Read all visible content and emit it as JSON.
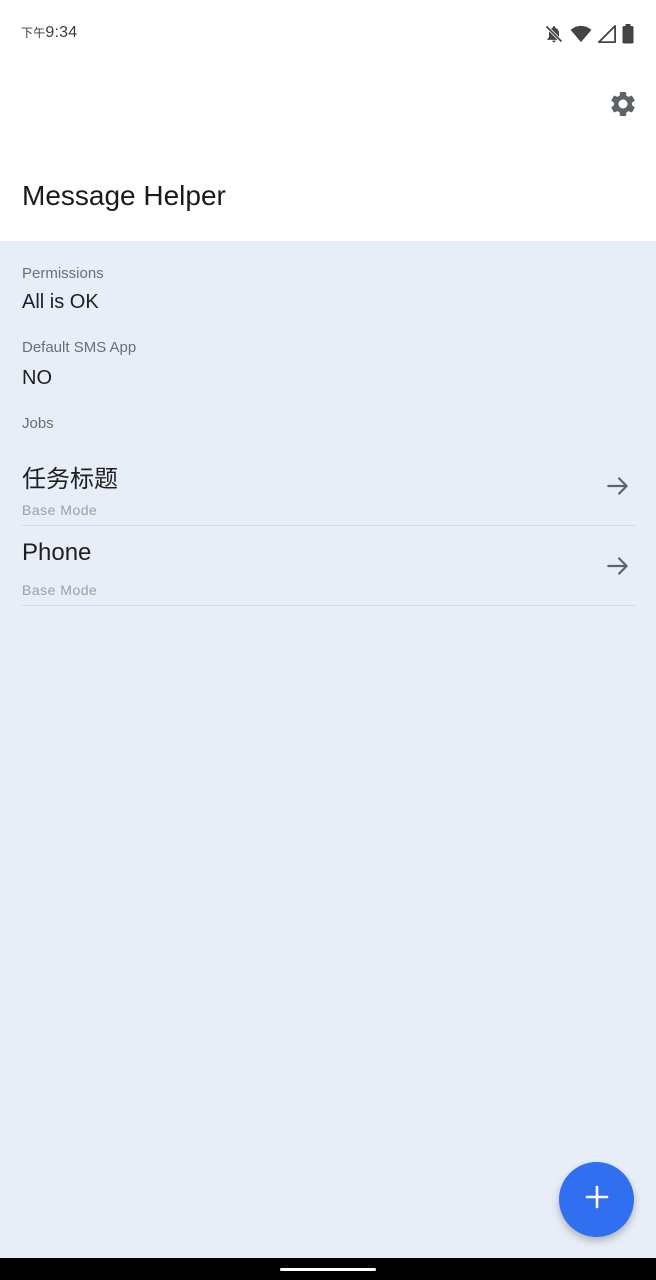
{
  "status_bar": {
    "time_prefix": "下午",
    "time": "9:34",
    "icons": [
      "notifications-off-icon",
      "wifi-icon",
      "cell-signal-icon",
      "battery-icon"
    ]
  },
  "header": {
    "title": "Message Helper",
    "settings_icon": "gear-icon"
  },
  "permissions": {
    "label": "Permissions",
    "value": "All is OK"
  },
  "default_sms": {
    "label": "Default SMS App",
    "value": "NO"
  },
  "jobs": {
    "label": "Jobs",
    "items": [
      {
        "title": "任务标题",
        "subtitle": "Base Mode",
        "icon": "arrow-right-icon"
      },
      {
        "title": "Phone",
        "subtitle": "Base Mode",
        "icon": "arrow-right-icon"
      }
    ]
  },
  "fab": {
    "icon": "plus-icon"
  },
  "colors": {
    "accent": "#2f6ff0",
    "background": "#e8eef7",
    "header_background": "#ffffff"
  }
}
